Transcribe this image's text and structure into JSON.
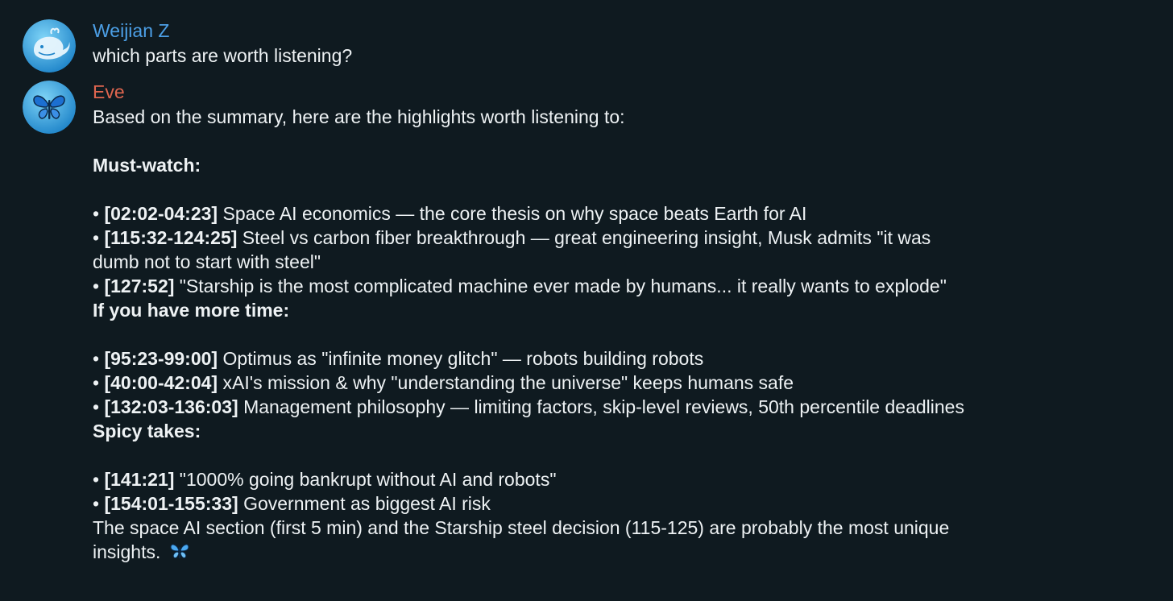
{
  "colors": {
    "background": "#0f1a20",
    "text": "#eef2f4",
    "user_name": "#4c9fe6",
    "bot_name": "#e0664f"
  },
  "messages": [
    {
      "sender": "Weijian Z",
      "avatar_icon": "whale-avatar-icon",
      "text": "which parts are worth listening?"
    },
    {
      "sender": "Eve",
      "avatar_icon": "butterfly-avatar-icon",
      "intro": "Based on the summary, here are the highlights worth listening to:",
      "sections": [
        {
          "heading": "Must-watch:",
          "items": [
            {
              "bullet": "•",
              "time": "[02:02-04:23]",
              "text": "Space AI economics — the core thesis on why space beats Earth for AI"
            },
            {
              "bullet": "•",
              "time": "[115:32-124:25]",
              "text": "Steel vs carbon fiber breakthrough — great engineering insight, Musk admits \"it was",
              "cont": "dumb not to start with steel\""
            },
            {
              "bullet": "•",
              "time": "[127:52]",
              "text": "\"Starship is the most complicated machine ever made by humans... it really wants to explode\""
            }
          ]
        },
        {
          "heading": "If you have more time:",
          "items": [
            {
              "bullet": "•",
              "time": "[95:23-99:00]",
              "text": "Optimus as \"infinite money glitch\" — robots building robots"
            },
            {
              "bullet": "•",
              "time": "[40:00-42:04]",
              "text": "xAI's mission & why \"understanding the universe\" keeps humans safe"
            },
            {
              "bullet": "•",
              "time": "[132:03-136:03]",
              "text": "Management philosophy — limiting factors, skip-level reviews, 50th percentile deadlines"
            }
          ]
        },
        {
          "heading": "Spicy takes:",
          "items": [
            {
              "bullet": "•",
              "time": "[141:21]",
              "text": "\"1000% going bankrupt without AI and robots\""
            },
            {
              "bullet": "•",
              "time": "[154:01-155:33]",
              "text": "Government as biggest AI risk"
            }
          ]
        }
      ],
      "closing": "The space AI section (first 5 min) and the Starship steel decision (115-125) are probably the most unique",
      "closing_cont": "insights.",
      "closing_icon": "butterfly-emoji-icon"
    }
  ]
}
